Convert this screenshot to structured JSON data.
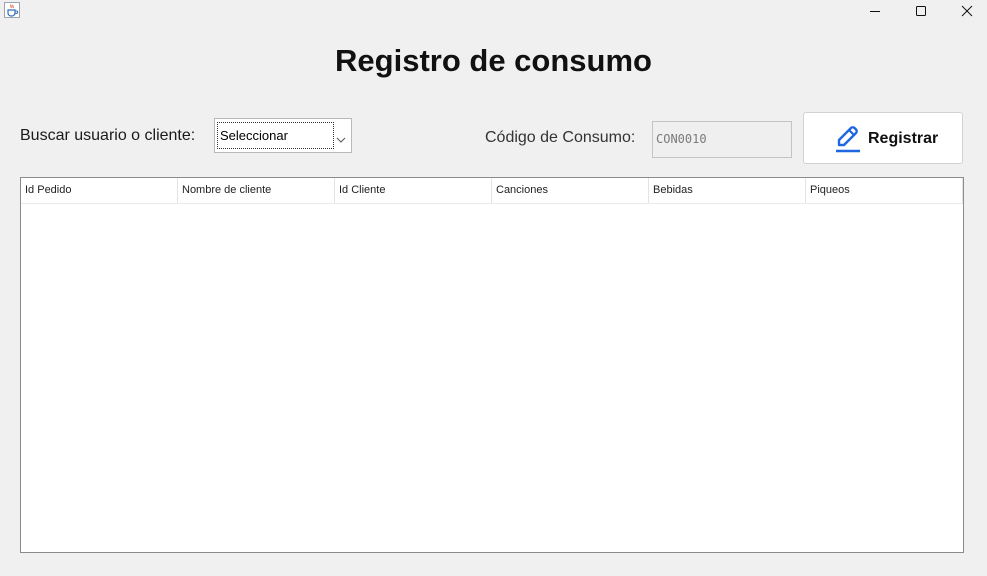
{
  "window": {
    "icon": "java-cup-icon",
    "controls": [
      "minimize-icon",
      "maximize-icon",
      "close-icon"
    ]
  },
  "page": {
    "title": "Registro de consumo"
  },
  "search": {
    "label": "Buscar usuario o cliente:",
    "selected": "Seleccionar"
  },
  "consumo": {
    "label": "Código de Consumo:",
    "code": "CON0010"
  },
  "register_button": {
    "label": "Registrar",
    "icon": "pencil-icon",
    "icon_color": "#1f66e0"
  },
  "table": {
    "columns": [
      "Id Pedido",
      "Nombre de cliente",
      "Id Cliente",
      "Canciones",
      "Bebidas",
      "Piqueos"
    ],
    "rows": []
  }
}
